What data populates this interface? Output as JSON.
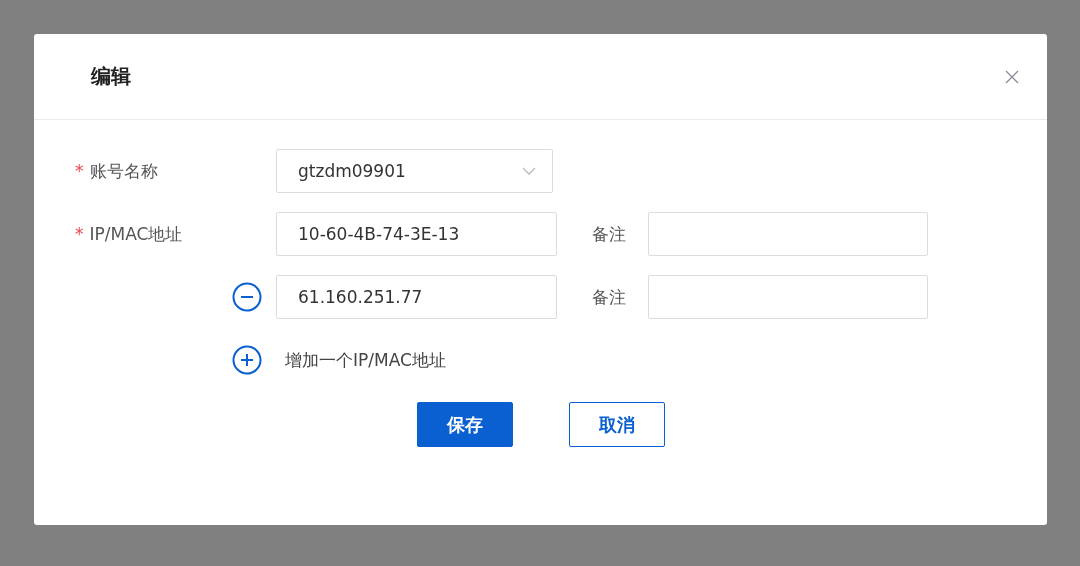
{
  "dialog": {
    "title": "编辑"
  },
  "account": {
    "mark": "*",
    "label": "账号名称",
    "value": "gtzdm09901"
  },
  "address": {
    "mark": "*",
    "label": "IP/MAC地址"
  },
  "entries": [
    {
      "value": "10-60-4B-74-3E-13",
      "note_label": "备注",
      "removable": false
    },
    {
      "value": "61.160.251.77",
      "note_label": "备注",
      "removable": true
    }
  ],
  "add_label": "增加一个IP/MAC地址",
  "buttons": [
    {
      "label": "保存",
      "kind": "primary"
    },
    {
      "label": "取消",
      "kind": "secondary"
    }
  ]
}
